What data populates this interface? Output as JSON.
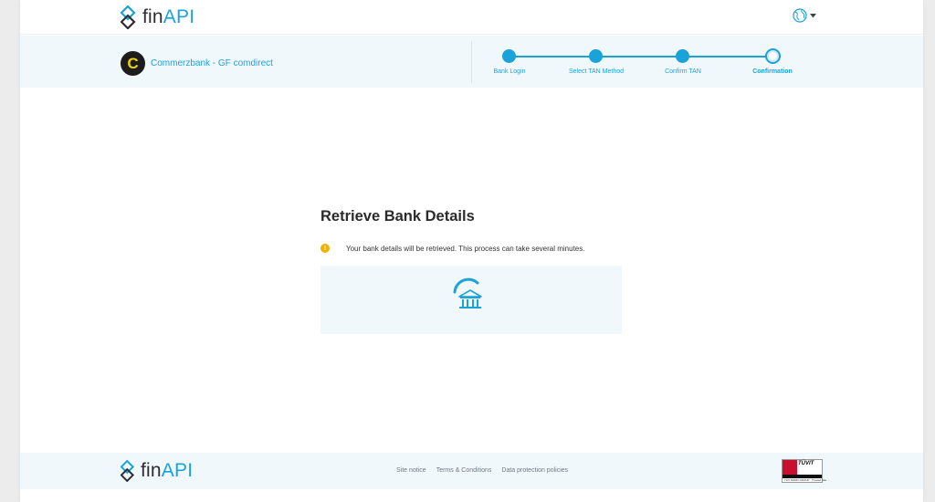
{
  "header": {
    "logo_fin": "fin",
    "logo_api": "API",
    "language_icon": "globe-icon",
    "dropdown_icon": "caret-down-icon"
  },
  "bank": {
    "logo_letter": "C",
    "name": "Commerzbank - GF comdirect"
  },
  "steps": [
    {
      "label": "Bank Login",
      "state": "done"
    },
    {
      "label": "Select TAN Method",
      "state": "done"
    },
    {
      "label": "Confirm TAN",
      "state": "done"
    },
    {
      "label": "Confirmation",
      "state": "current"
    }
  ],
  "main": {
    "title": "Retrieve Bank Details",
    "info_icon_glyph": "!",
    "info_text": "Your bank details will be retrieved. This process can take several minutes.",
    "loader_icon": "bank-building-icon"
  },
  "footer": {
    "logo_fin": "fin",
    "logo_api": "API",
    "links": [
      "Site notice",
      "Terms & Conditions",
      "Data protection policies"
    ],
    "badge_text": "TÜVIT",
    "badge_sub": "TÜV NORD GROUP · Trusted Site"
  },
  "colors": {
    "accent": "#1aa3d9",
    "band_background": "#f1f8fc",
    "warning": "#f5b100",
    "bank_logo_bg": "#1c1c1c",
    "bank_logo_fg": "#f2d300"
  }
}
